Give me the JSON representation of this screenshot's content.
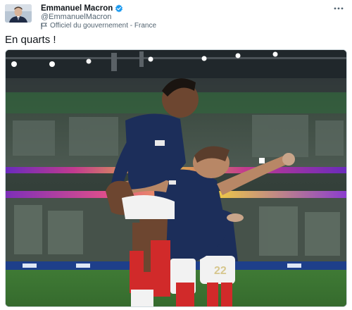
{
  "author": {
    "display_name": "Emmanuel Macron",
    "handle": "@EmmanuelMacron",
    "affiliation_label": "Officiel du gouvernement - France",
    "avatar_icon": "profile-photo",
    "verified_icon": "verified-badge-icon",
    "affiliation_icon": "flag-icon"
  },
  "more_icon": "more-dots-icon",
  "tweet": {
    "text": "En quarts !"
  },
  "media": {
    "type": "photo"
  },
  "colors": {
    "verified": "#1d9bf0",
    "secondary_text": "#536471",
    "primary_text": "#0f1419",
    "jersey_blue": "#1c2e5a",
    "pitch_green": "#3f7a35"
  }
}
